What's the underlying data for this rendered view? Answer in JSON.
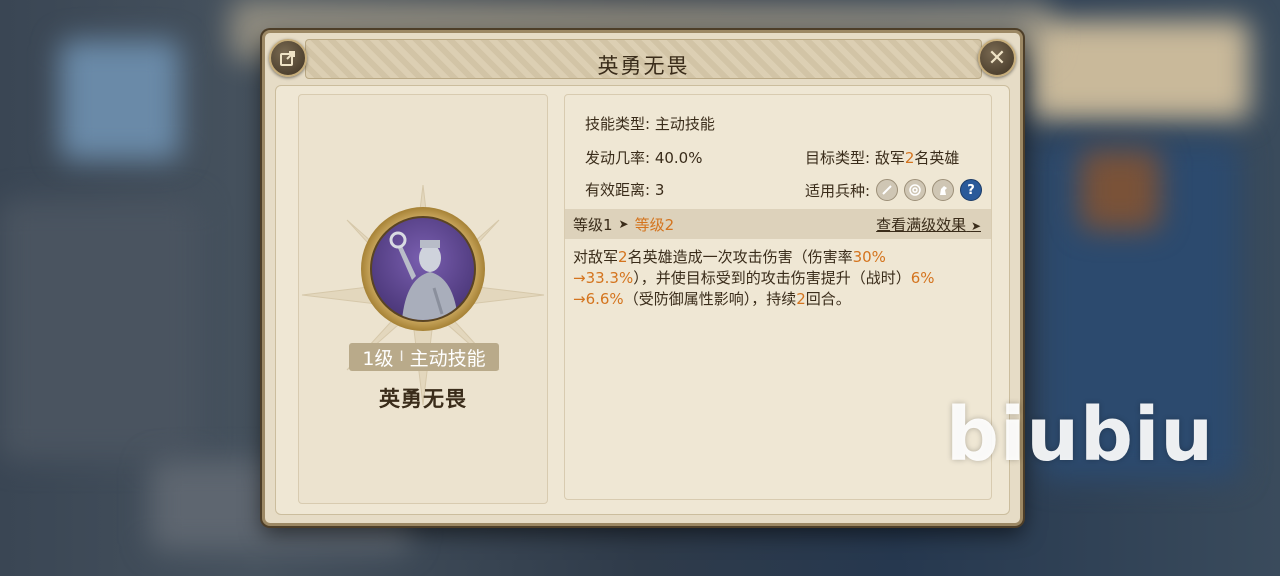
{
  "dialog": {
    "title": "英勇无畏",
    "share_icon": "share-icon",
    "close_icon": "close-icon",
    "close_glyph": "✕"
  },
  "skill": {
    "level_label": "1级",
    "separator": "I",
    "type_label": "主动技能",
    "name": "英勇无畏"
  },
  "info": {
    "skill_type_key": "技能类型: ",
    "skill_type_value": "主动技能",
    "trigger_rate_key": "发动几率: ",
    "trigger_rate_value": "40.0%",
    "range_key": "有效距离: ",
    "range_value": "3",
    "target_key": "目标类型: ",
    "target_prefix": "敌军",
    "target_num": "2",
    "target_suffix": "名英雄",
    "unit_key": "适用兵种: ",
    "unit_icons": [
      "infantry-icon",
      "archer-icon",
      "cavalry-icon",
      "help-icon"
    ],
    "help_glyph": "?"
  },
  "levels": {
    "current": "等级1",
    "next": "等级2",
    "view_max": "查看满级效果"
  },
  "description": {
    "p1": "对敌军",
    "n1": "2",
    "p2": "名英雄造成一次攻击伤害（伤害率",
    "n2": "30%",
    "n3": "→33.3%",
    "p3": "），并使目标受到的攻击伤害提升（战时）",
    "n4": "6%",
    "n5": "→6.6%",
    "p4": "（受防御属性影响），持续",
    "n6": "2",
    "p5": "回合。"
  },
  "watermark": "biubiu",
  "colors": {
    "highlight": "#d4741e",
    "text": "#3a2c1a",
    "panel": "#e6dcc6"
  }
}
